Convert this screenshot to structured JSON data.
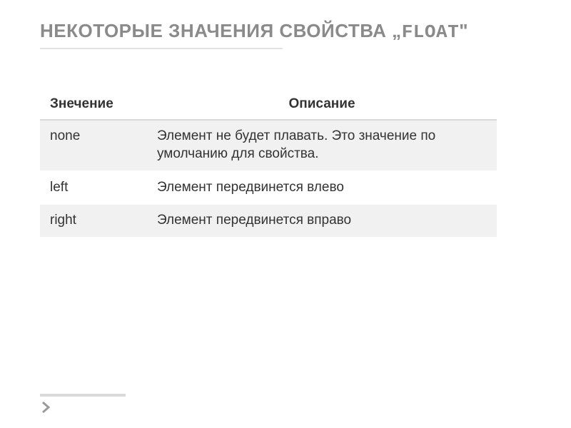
{
  "title": {
    "prefix": "НЕКОТОРЫЕ ЗНАЧЕНИЯ СВОЙСТВА „",
    "code": "FLOAT",
    "suffix": "\""
  },
  "table": {
    "headers": {
      "value": "Знечение",
      "description": "Описание"
    },
    "rows": [
      {
        "value": "none",
        "description": "Элемент не будет плавать. Это значение по умолчанию для свойства."
      },
      {
        "value": "left",
        "description": "Элемент передвинется влево"
      },
      {
        "value": "right",
        "description": "Элемент передвинется вправо"
      }
    ]
  }
}
